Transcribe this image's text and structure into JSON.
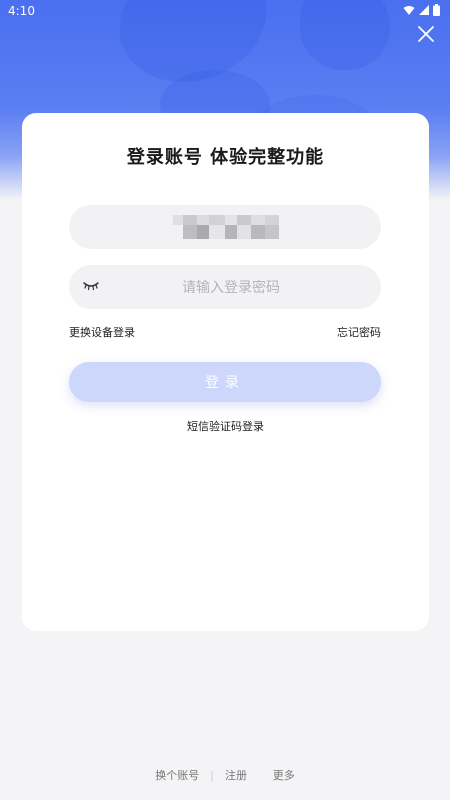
{
  "status_bar": {
    "time": "4:10",
    "icons": [
      "wifi-icon",
      "signal-icon",
      "battery-icon"
    ]
  },
  "header": {
    "close_icon": "close-icon"
  },
  "card": {
    "title": "登录账号 体验完整功能",
    "account_field": {
      "value": "",
      "masked": true
    },
    "password_field": {
      "placeholder": "请输入登录密码",
      "toggle_icon": "eye-closed-icon"
    },
    "change_device_login": "更换设备登录",
    "forgot_password": "忘记密码",
    "login_button": "登录",
    "sms_login": "短信验证码登录"
  },
  "footer": {
    "switch_account": "换个账号",
    "separator": "|",
    "register": "注册",
    "more": "更多"
  },
  "colors": {
    "brand_blue": "#4a6ff0",
    "login_button_disabled": "#cdd6fb",
    "page_bg": "#f4f4f6"
  }
}
